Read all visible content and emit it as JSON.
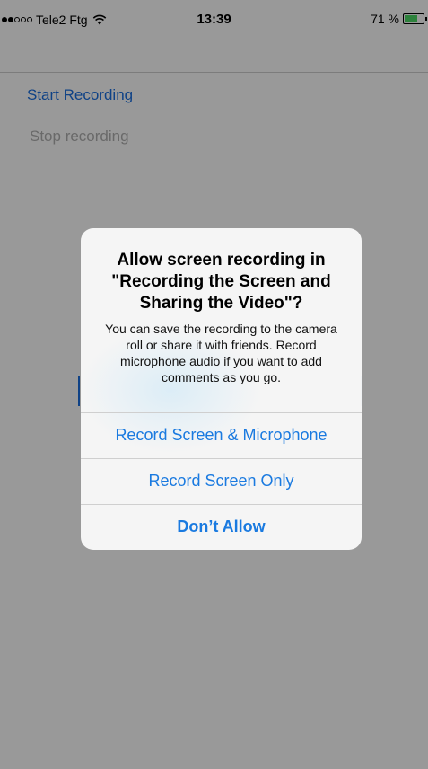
{
  "status_bar": {
    "carrier": "Tele2 Ftg",
    "time": "13:39",
    "battery_percent": "71 %",
    "battery_level": 0.71,
    "signal_bars_filled": 2,
    "signal_bars_total": 5,
    "wifi_icon": "wifi-icon",
    "battery_color": "#4cd964"
  },
  "app": {
    "start_recording_label": "Start Recording",
    "stop_recording_label": "Stop recording",
    "accent_color": "#1a6fe0"
  },
  "alert": {
    "title": "Allow screen recording in \"Recording the Screen and Sharing the Video\"?",
    "message": "You can save the recording to the camera roll or share it with friends. Record microphone audio if you want to add comments as you go.",
    "actions": [
      {
        "label": "Record Screen & Microphone"
      },
      {
        "label": "Record Screen Only"
      },
      {
        "label": "Don’t Allow"
      }
    ]
  }
}
